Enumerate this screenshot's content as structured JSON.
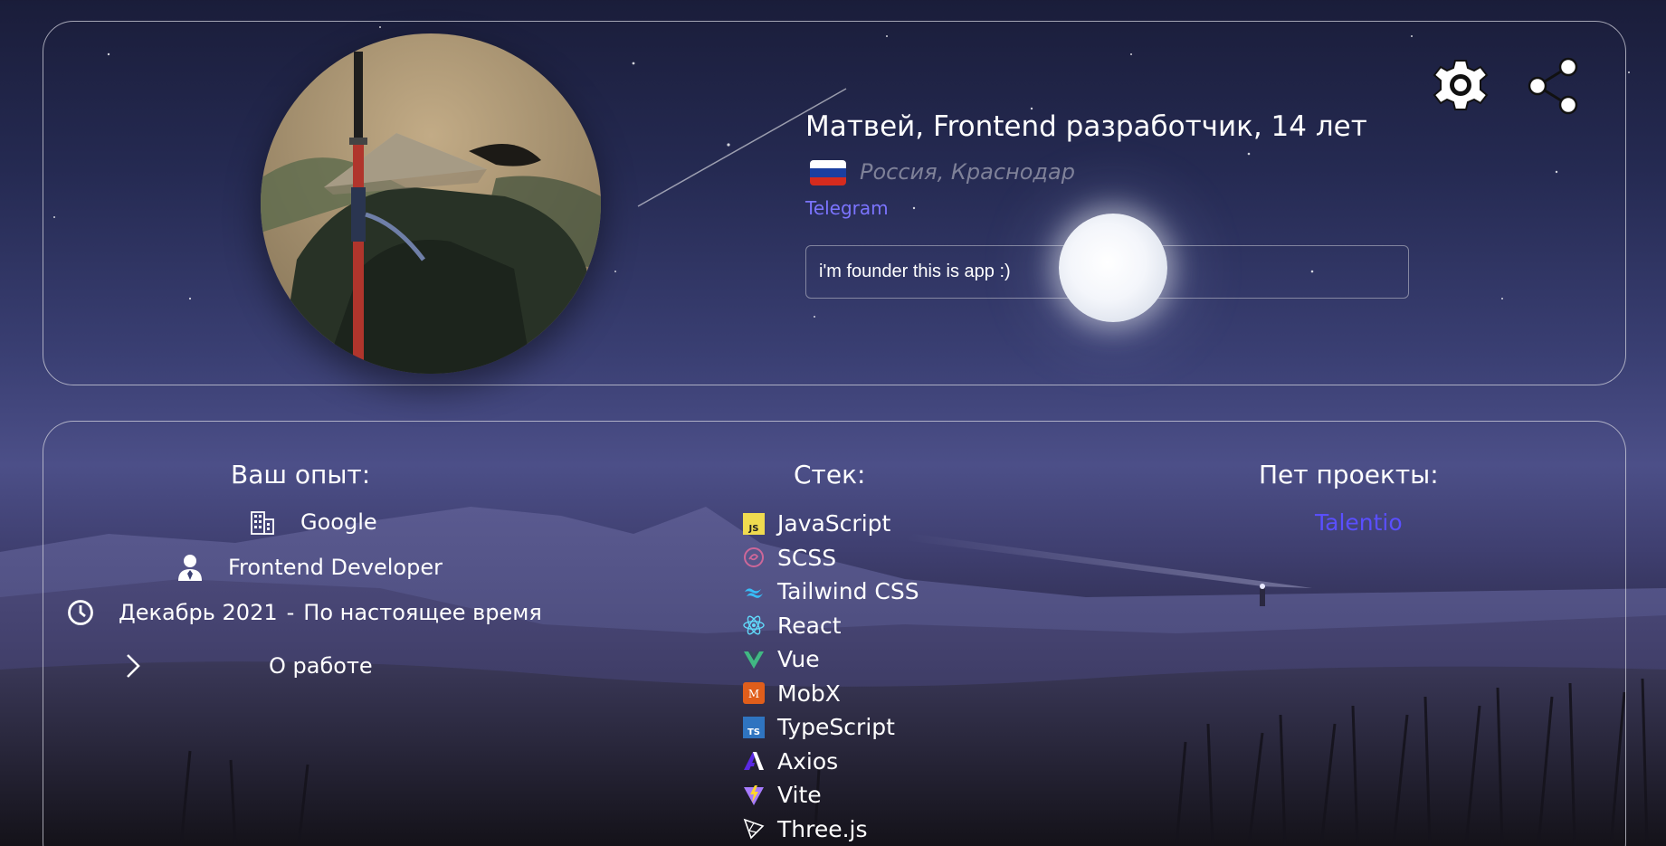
{
  "profile": {
    "name_line": "Матвей, Frontend разработчик, 14 лет",
    "location": "Россия, Краснодар",
    "telegram_label": "Telegram",
    "bio": "i'm founder this is app :)"
  },
  "header_icons": {
    "settings": "gear-icon",
    "share": "share-icon"
  },
  "experience": {
    "title": "Ваш опыт:",
    "company": "Google",
    "position": "Frontend Developer",
    "period_start": "Декабрь 2021",
    "period_sep": "-",
    "period_end": "По настоящее время",
    "about_label": "О работе"
  },
  "stack": {
    "title": "Стек:",
    "items": [
      {
        "label": "JavaScript",
        "icon": "javascript-icon"
      },
      {
        "label": "SCSS",
        "icon": "sass-icon"
      },
      {
        "label": "Tailwind CSS",
        "icon": "tailwind-icon"
      },
      {
        "label": "React",
        "icon": "react-icon"
      },
      {
        "label": "Vue",
        "icon": "vue-icon"
      },
      {
        "label": "MobX",
        "icon": "mobx-icon"
      },
      {
        "label": "TypeScript",
        "icon": "typescript-icon"
      },
      {
        "label": "Axios",
        "icon": "axios-icon"
      },
      {
        "label": "Vite",
        "icon": "vite-icon"
      },
      {
        "label": "Three.js",
        "icon": "threejs-icon"
      }
    ]
  },
  "pet_projects": {
    "title": "Пет проекты:",
    "items": [
      "Talentio"
    ]
  },
  "colors": {
    "link": "#7b74ff",
    "project_link": "#5a4fff",
    "card_border": "#d2d2dc"
  }
}
